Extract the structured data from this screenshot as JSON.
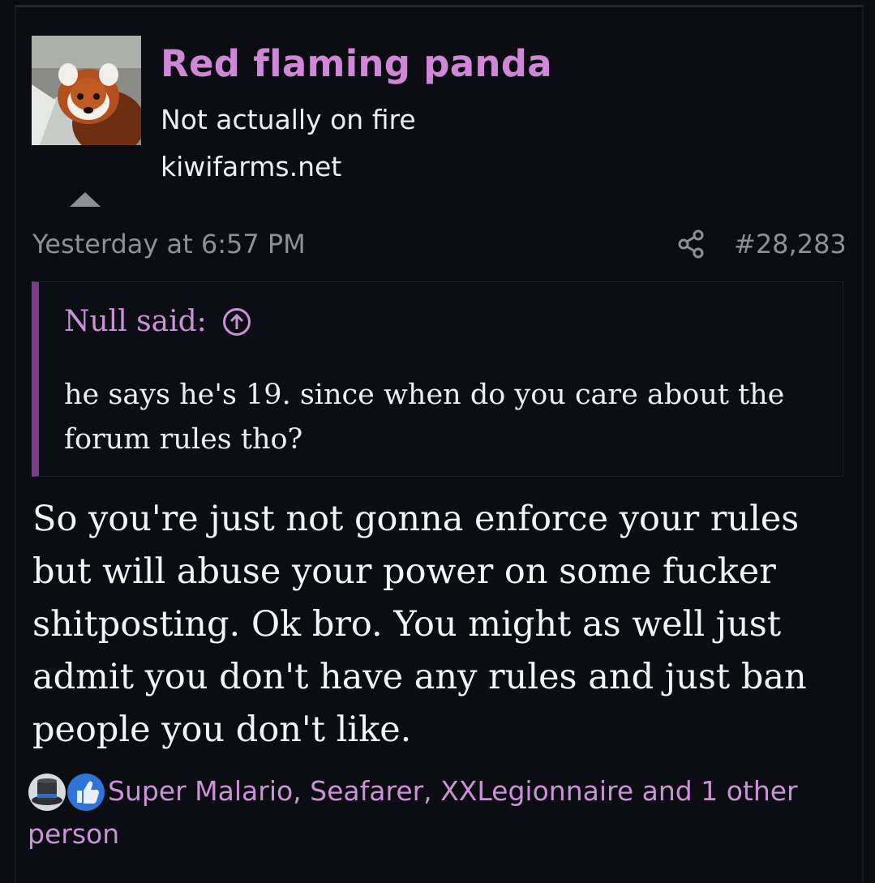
{
  "user": {
    "name": "Red flaming panda",
    "title": "Not actually on fire",
    "extra": "kiwifarms.net",
    "avatar_icon": "red-panda-avatar"
  },
  "post": {
    "date": "Yesterday at 6:57 PM",
    "number": "#28,283",
    "share_icon": "share-icon"
  },
  "quote": {
    "author": "Null said:",
    "body": "he says he's 19. since when do you care about the forum rules tho?"
  },
  "body": "So you're just not gonna enforce your rules but will abuse your power on some fucker shitposting. Ok bro. You might as well just admit you don't have any rules and just ban people you don't like.",
  "reactions": {
    "icons": [
      "top-hat-icon",
      "thumbs-up-icon"
    ],
    "text": "Super Malario, Seafarer, XXLegionnaire and 1 other person"
  },
  "colors": {
    "background": "#0b0d12",
    "accent": "#d087d7",
    "quote_bar": "#7a3c88",
    "muted": "#8e9097",
    "text": "#eceef1"
  }
}
